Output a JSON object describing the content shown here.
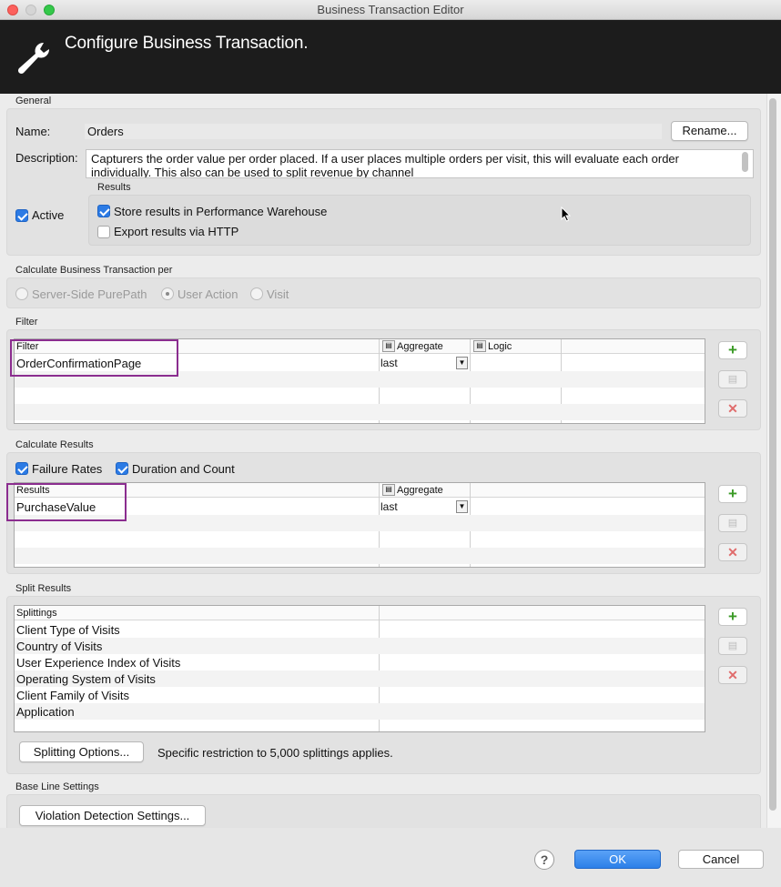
{
  "window": {
    "title": "Business Transaction Editor"
  },
  "banner": {
    "title": "Configure Business Transaction.",
    "icon": "wrench-icon"
  },
  "general": {
    "section_label": "General",
    "name_label": "Name:",
    "name_value": "Orders",
    "rename_label": "Rename...",
    "description_label": "Description:",
    "description_line1": "Capturers the order value per order placed. If a user places multiple orders per visit, this will evaluate each order",
    "description_line2": "individually.  This also can be used to split revenue by channel",
    "active_label": "Active",
    "active_checked": true,
    "results_label": "Results",
    "store_label": "Store results in Performance Warehouse",
    "store_checked": true,
    "export_label": "Export results via HTTP",
    "export_checked": false
  },
  "calc_per": {
    "section_label": "Calculate Business Transaction per",
    "options": [
      "Server-Side PurePath",
      "User Action",
      "Visit"
    ],
    "selected": "User Action"
  },
  "filter": {
    "section_label": "Filter",
    "col_filter": "Filter",
    "col_aggregate": "Aggregate",
    "col_logic": "Logic",
    "rows": [
      {
        "name": "OrderConfirmationPage",
        "aggregate": "last"
      }
    ]
  },
  "calc_results": {
    "section_label": "Calculate Results",
    "failure_label": "Failure Rates",
    "failure_checked": true,
    "duration_label": "Duration and Count",
    "duration_checked": true,
    "col_results": "Results",
    "col_aggregate": "Aggregate",
    "rows": [
      {
        "name": "PurchaseValue",
        "aggregate": "last"
      }
    ]
  },
  "split": {
    "section_label": "Split Results",
    "col_splittings": "Splittings",
    "rows": [
      "Client Type of Visits",
      "Country of Visits",
      "User Experience Index of Visits",
      "Operating System of Visits",
      "Client Family of Visits",
      "Application"
    ],
    "options_button": "Splitting Options...",
    "restriction_text": "Specific restriction to 5,000 splittings applies."
  },
  "baseline": {
    "section_label": "Base Line Settings",
    "violation_button": "Violation Detection Settings..."
  },
  "footer": {
    "help": "?",
    "ok": "OK",
    "cancel": "Cancel"
  },
  "colors": {
    "banner": "#1c1c1c",
    "accent": "#2c7be5",
    "highlight": "#8b2d8f",
    "ok_button": "#2c80e8"
  }
}
